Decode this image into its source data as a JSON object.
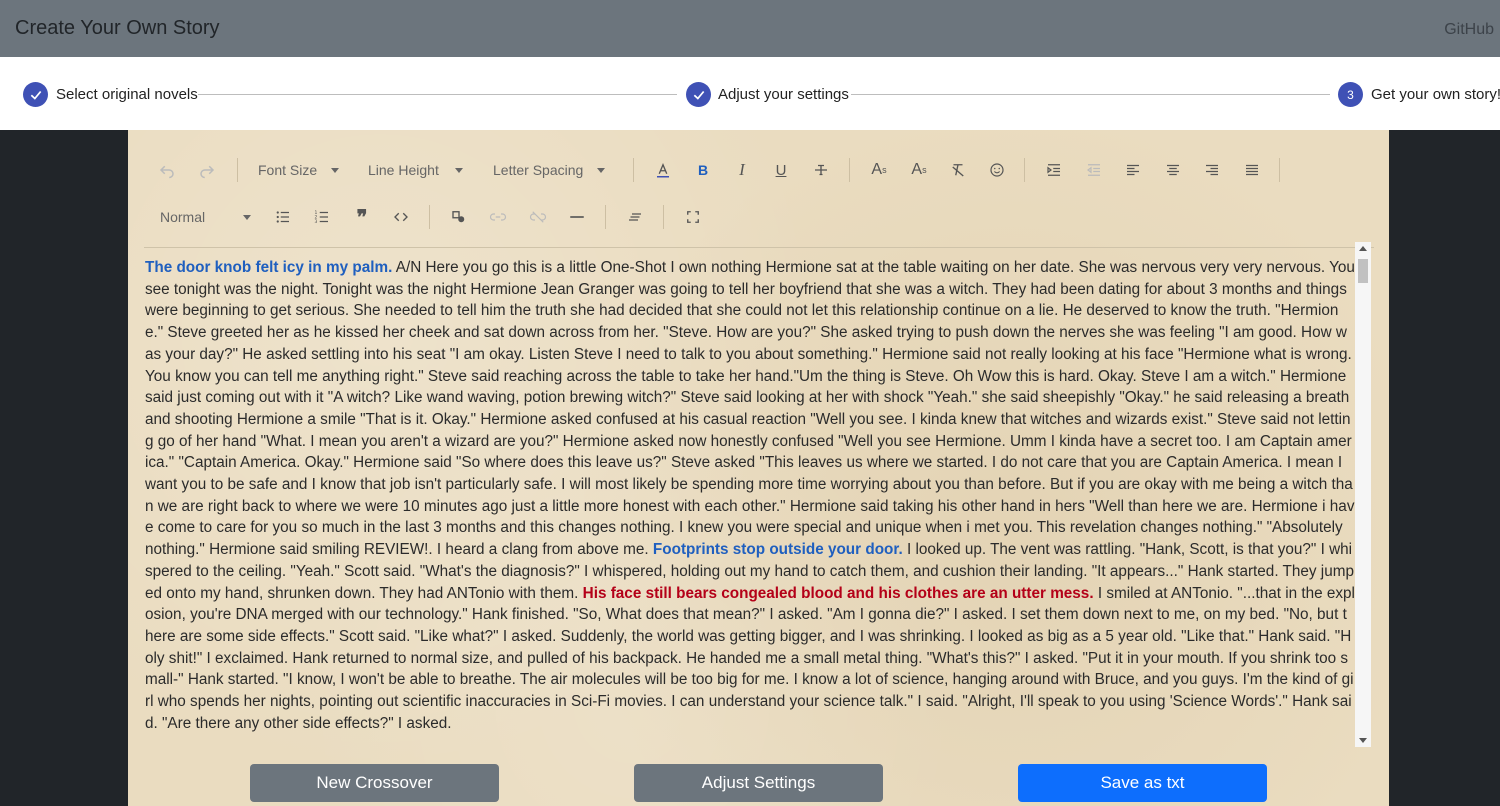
{
  "navbar": {
    "brand": "Create Your Own Story",
    "github": "GitHub"
  },
  "stepper": {
    "steps": [
      {
        "label": "Select original novels",
        "state": "done"
      },
      {
        "label": "Adjust your settings",
        "state": "done"
      },
      {
        "label": "Get your own story!",
        "state": "active",
        "number": "3"
      }
    ]
  },
  "toolbar": {
    "font_size": "Font Size",
    "line_height": "Line Height",
    "letter_spacing": "Letter Spacing",
    "block_type": "Normal"
  },
  "story": {
    "s1": "The door knob felt icy in my palm.",
    "t1": " A/N Here you go this is a little One-Shot I own nothing Hermione sat at the table waiting on her date. She was nervous very very nervous. You see tonight was the night. Tonight was the night Hermione Jean Granger was going to tell her boyfriend that she was a witch. They had been dating for about 3 months and things were beginning to get serious. She needed to tell him the truth she had decided that she could not let this relationship continue on a lie. He deserved to know the truth. \"Hermione.\" Steve greeted her as he kissed her cheek and sat down across from her. \"Steve. How are you?\" She asked trying to push down the nerves she was feeling \"I am good. How was your day?\" He asked settling into his seat \"I am okay. Listen Steve I need to talk to you about something.\" Hermione said not really looking at his face \"Hermione what is wrong. You know you can tell me anything right.\" Steve said reaching across the table to take her hand.\"Um the thing is Steve. Oh Wow this is hard. Okay. Steve I am a witch.\" Hermione said just coming out with it \"A witch? Like wand waving, potion brewing witch?\" Steve said looking at her with shock \"Yeah.\" she said sheepishly \"Okay.\" he said releasing a breath and shooting Hermione a smile \"That is it. Okay.\" Hermione asked confused at his casual reaction \"Well you see. I kinda knew that witches and wizards exist.\" Steve said not letting go of her hand \"What. I mean you aren't a wizard are you?\" Hermione asked now honestly confused \"Well you see Hermione. Umm I kinda have a secret too. I am Captain america.\" \"Captain America. Okay.\" Hermione said \"So where does this leave us?\" Steve asked \"This leaves us where we started. I do not care that you are Captain America. I mean I want you to be safe and I know that job isn't particularly safe. I will most likely be spending more time worrying about you than before. But if you are okay with me being a witch than we are right back to where we were 10 minutes ago just a little more honest with each other.\" Hermione said taking his other hand in hers \"Well than here we are. Hermione i have come to care for you so much in the last 3 months and this changes nothing. I knew you were special and unique when i met you. This revelation changes nothing.\" \"Absolutely nothing.\" Hermione said smiling REVIEW!. I heard a clang from above me. ",
    "s2": "Footprints stop outside your door.",
    "t2": " I looked up. The vent was rattling. \"Hank, Scott, is that you?\" I whispered to the ceiling. \"Yeah.\" Scott said. \"What's the diagnosis?\" I whispered, holding out my hand to catch them, and cushion their landing. \"It appears...\" Hank started. They jumped onto my hand, shrunken down. They had ANTonio with them. ",
    "s3": "His face still bears congealed blood and his clothes are an utter mess.",
    "t3": " I smiled at ANTonio. \"...that in the explosion, you're DNA merged with our technology.\" Hank finished. \"So, What does that mean?\" I asked. \"Am I gonna die?\" I asked. I set them down next to me, on my bed. \"No, but there are some side effects.\" Scott said. \"Like what?\" I asked. Suddenly, the world was getting bigger, and I was shrinking. I looked as big as a 5 year old. \"Like that.\" Hank said. \"Holy shit!\" I exclaimed. Hank returned to normal size, and pulled of his backpack. He handed me a small metal thing. \"What's this?\" I asked. \"Put it in your mouth. If you shrink too small-\" Hank started. \"I know, I won't be able to breathe. The air molecules will be too big for me. I know a lot of science, hanging around with Bruce, and you guys. I'm the kind of girl who spends her nights, pointing out scientific inaccuracies in Sci-Fi movies. I can understand your science talk.\" I said. \"Alright, I'll speak to you using 'Science Words'.\" Hank said. \"Are there any other side effects?\" I asked."
  },
  "buttons": {
    "new_crossover": "New Crossover",
    "adjust_settings": "Adjust Settings",
    "save_txt": "Save as txt"
  },
  "colors": {
    "navbar": "#6c757d",
    "step_accent": "#3f51b5",
    "paper": "#eadcc0",
    "highlight_blue": "#1f5fbf",
    "highlight_red": "#b40018",
    "button_gray": "#6c757d",
    "button_blue": "#0d6efd"
  }
}
